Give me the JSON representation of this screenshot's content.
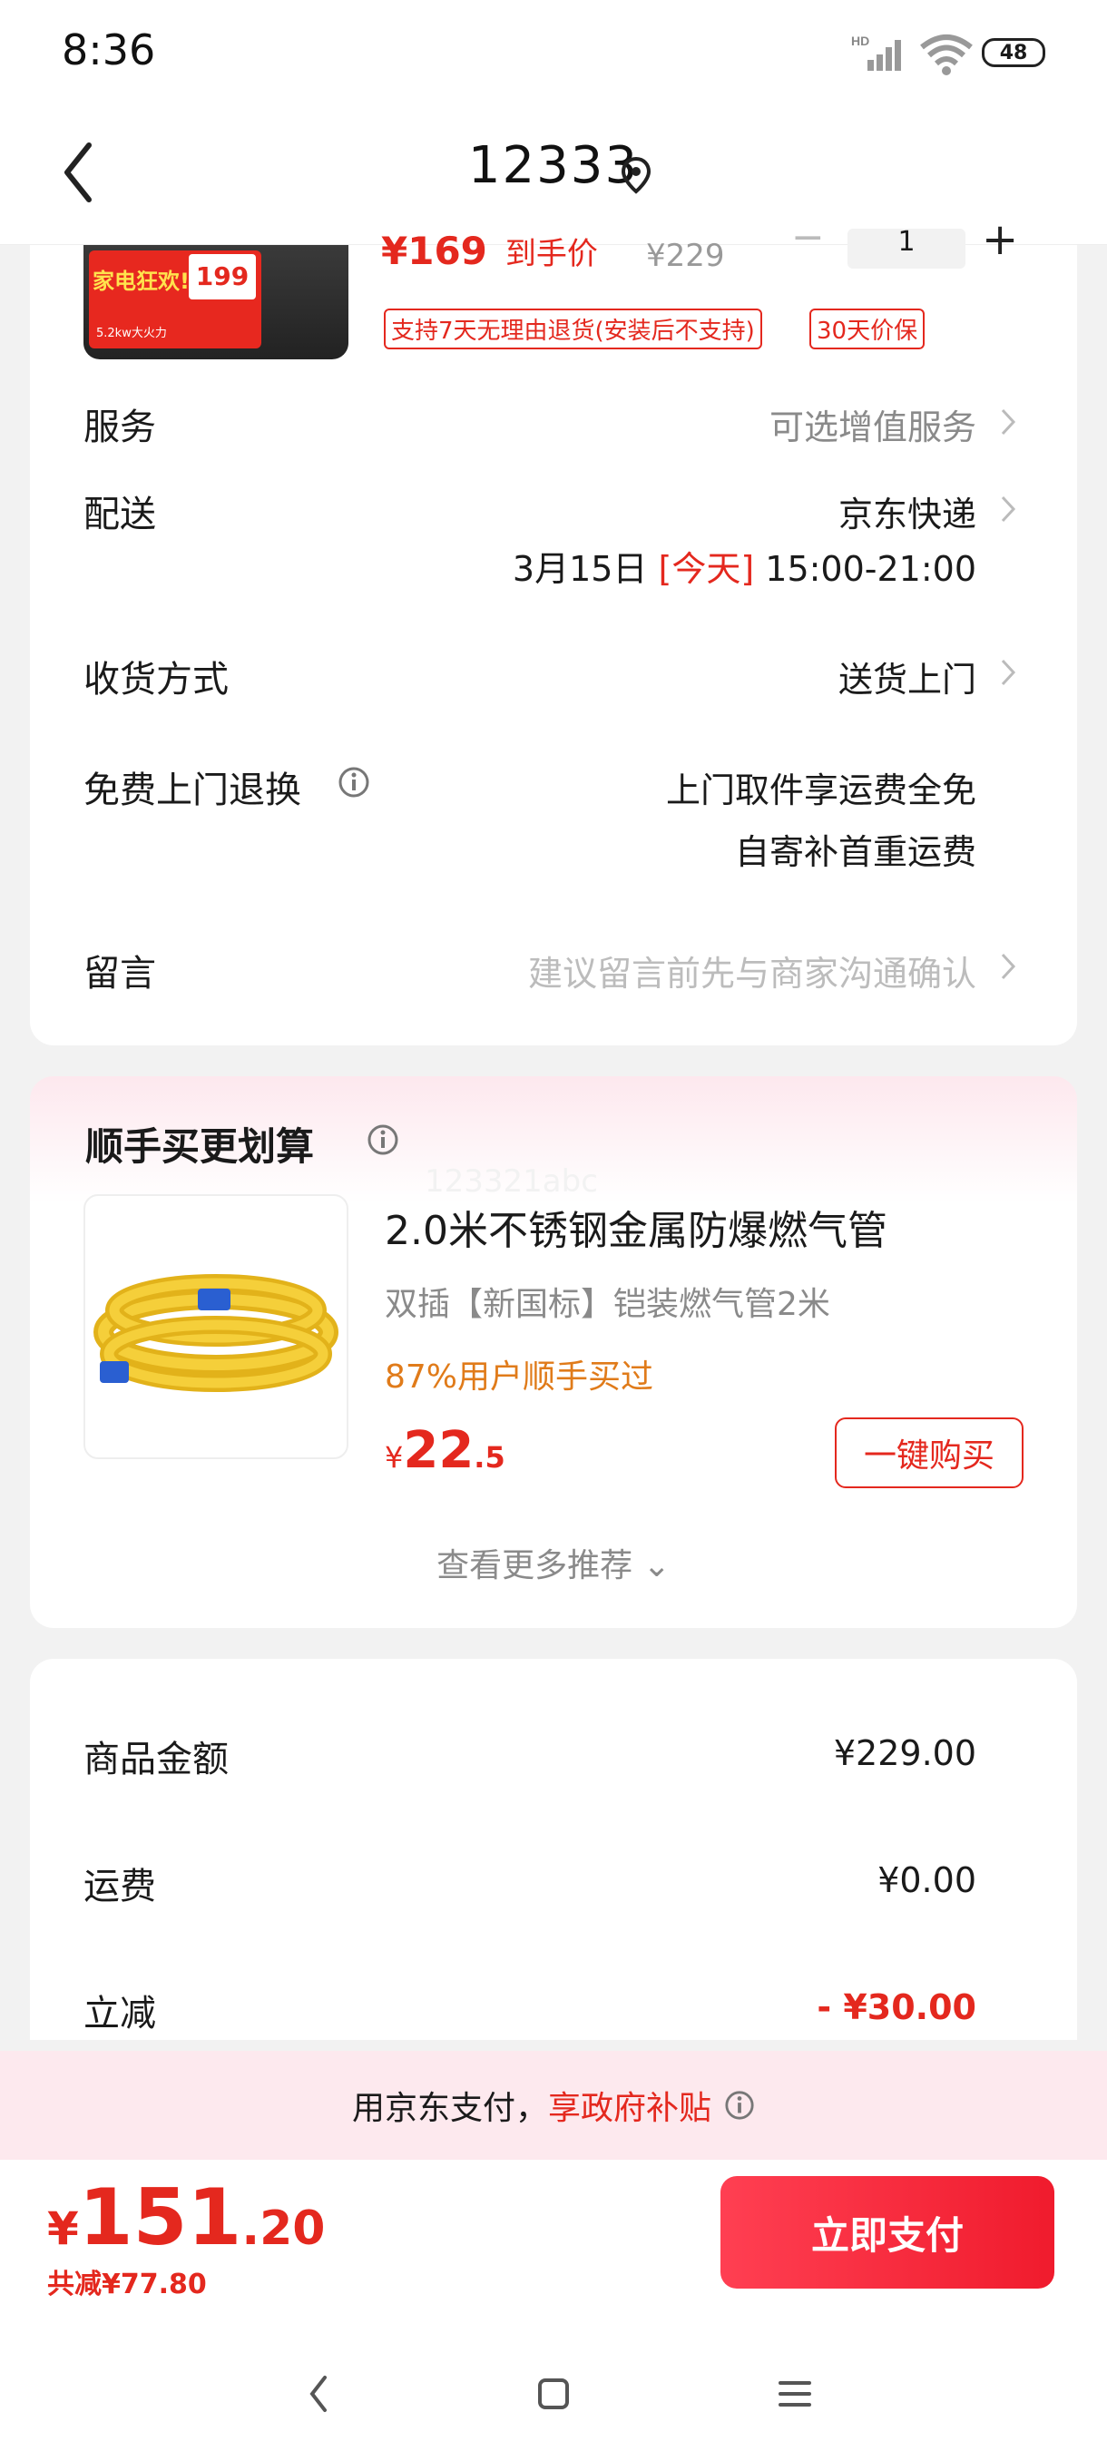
{
  "status_bar": {
    "time": "8:36",
    "network": "HD",
    "battery": "48"
  },
  "nav": {
    "title": "12333"
  },
  "product": {
    "price_label": "¥169",
    "price_tag": "到手价",
    "original_price": "¥229",
    "quantity": "1",
    "badges": [
      "支持7天无理由退货(安装后不支持)",
      "30天价保"
    ],
    "thumb_texts": {
      "promo": "家电狂欢!",
      "price": "199",
      "power": "5.2kw大火力"
    }
  },
  "rows": {
    "service": {
      "label": "服务",
      "value": "可选增值服务"
    },
    "delivery": {
      "label": "配送",
      "value": "京东快递",
      "date": "3月15日",
      "today": "[今天]",
      "time": "15:00-21:00"
    },
    "receive": {
      "label": "收货方式",
      "value": "送货上门"
    },
    "return": {
      "label": "免费上门退换",
      "line1": "上门取件享运费全免",
      "line2": "自寄补首重运费"
    },
    "message": {
      "label": "留言",
      "placeholder": "建议留言前先与商家沟通确认"
    }
  },
  "recommend": {
    "section_title": "顺手买更划算",
    "watermark": "123321abc",
    "item_title": "2.0米不锈钢金属防爆燃气管",
    "item_sub": "双插【新国标】铠装燃气管2米",
    "item_stat": "87%用户顺手买过",
    "price_symbol": "¥",
    "price_int": "22",
    "price_dec": ".5",
    "buy_label": "一键购买",
    "more_label": "查看更多推荐"
  },
  "summary": {
    "goods_label": "商品金额",
    "goods_value": "¥229.00",
    "freight_label": "运费",
    "freight_value": "¥0.00",
    "discount_label": "立减",
    "discount_value": "- ¥30.00"
  },
  "subsidy": {
    "prefix": "用京东支付，",
    "highlight": "享政府补贴"
  },
  "bottom": {
    "total_symbol": "¥",
    "total_int": "151",
    "total_dec": ".20",
    "saved": "共减¥77.80",
    "pay_label": "立即支付"
  },
  "colors": {
    "accent": "#e4281e",
    "pay_gradient_start": "#ff3f52",
    "pay_gradient_end": "#f01b2d",
    "subsidy_bg": "#fde9ee",
    "stat_orange": "#e07b1a"
  }
}
